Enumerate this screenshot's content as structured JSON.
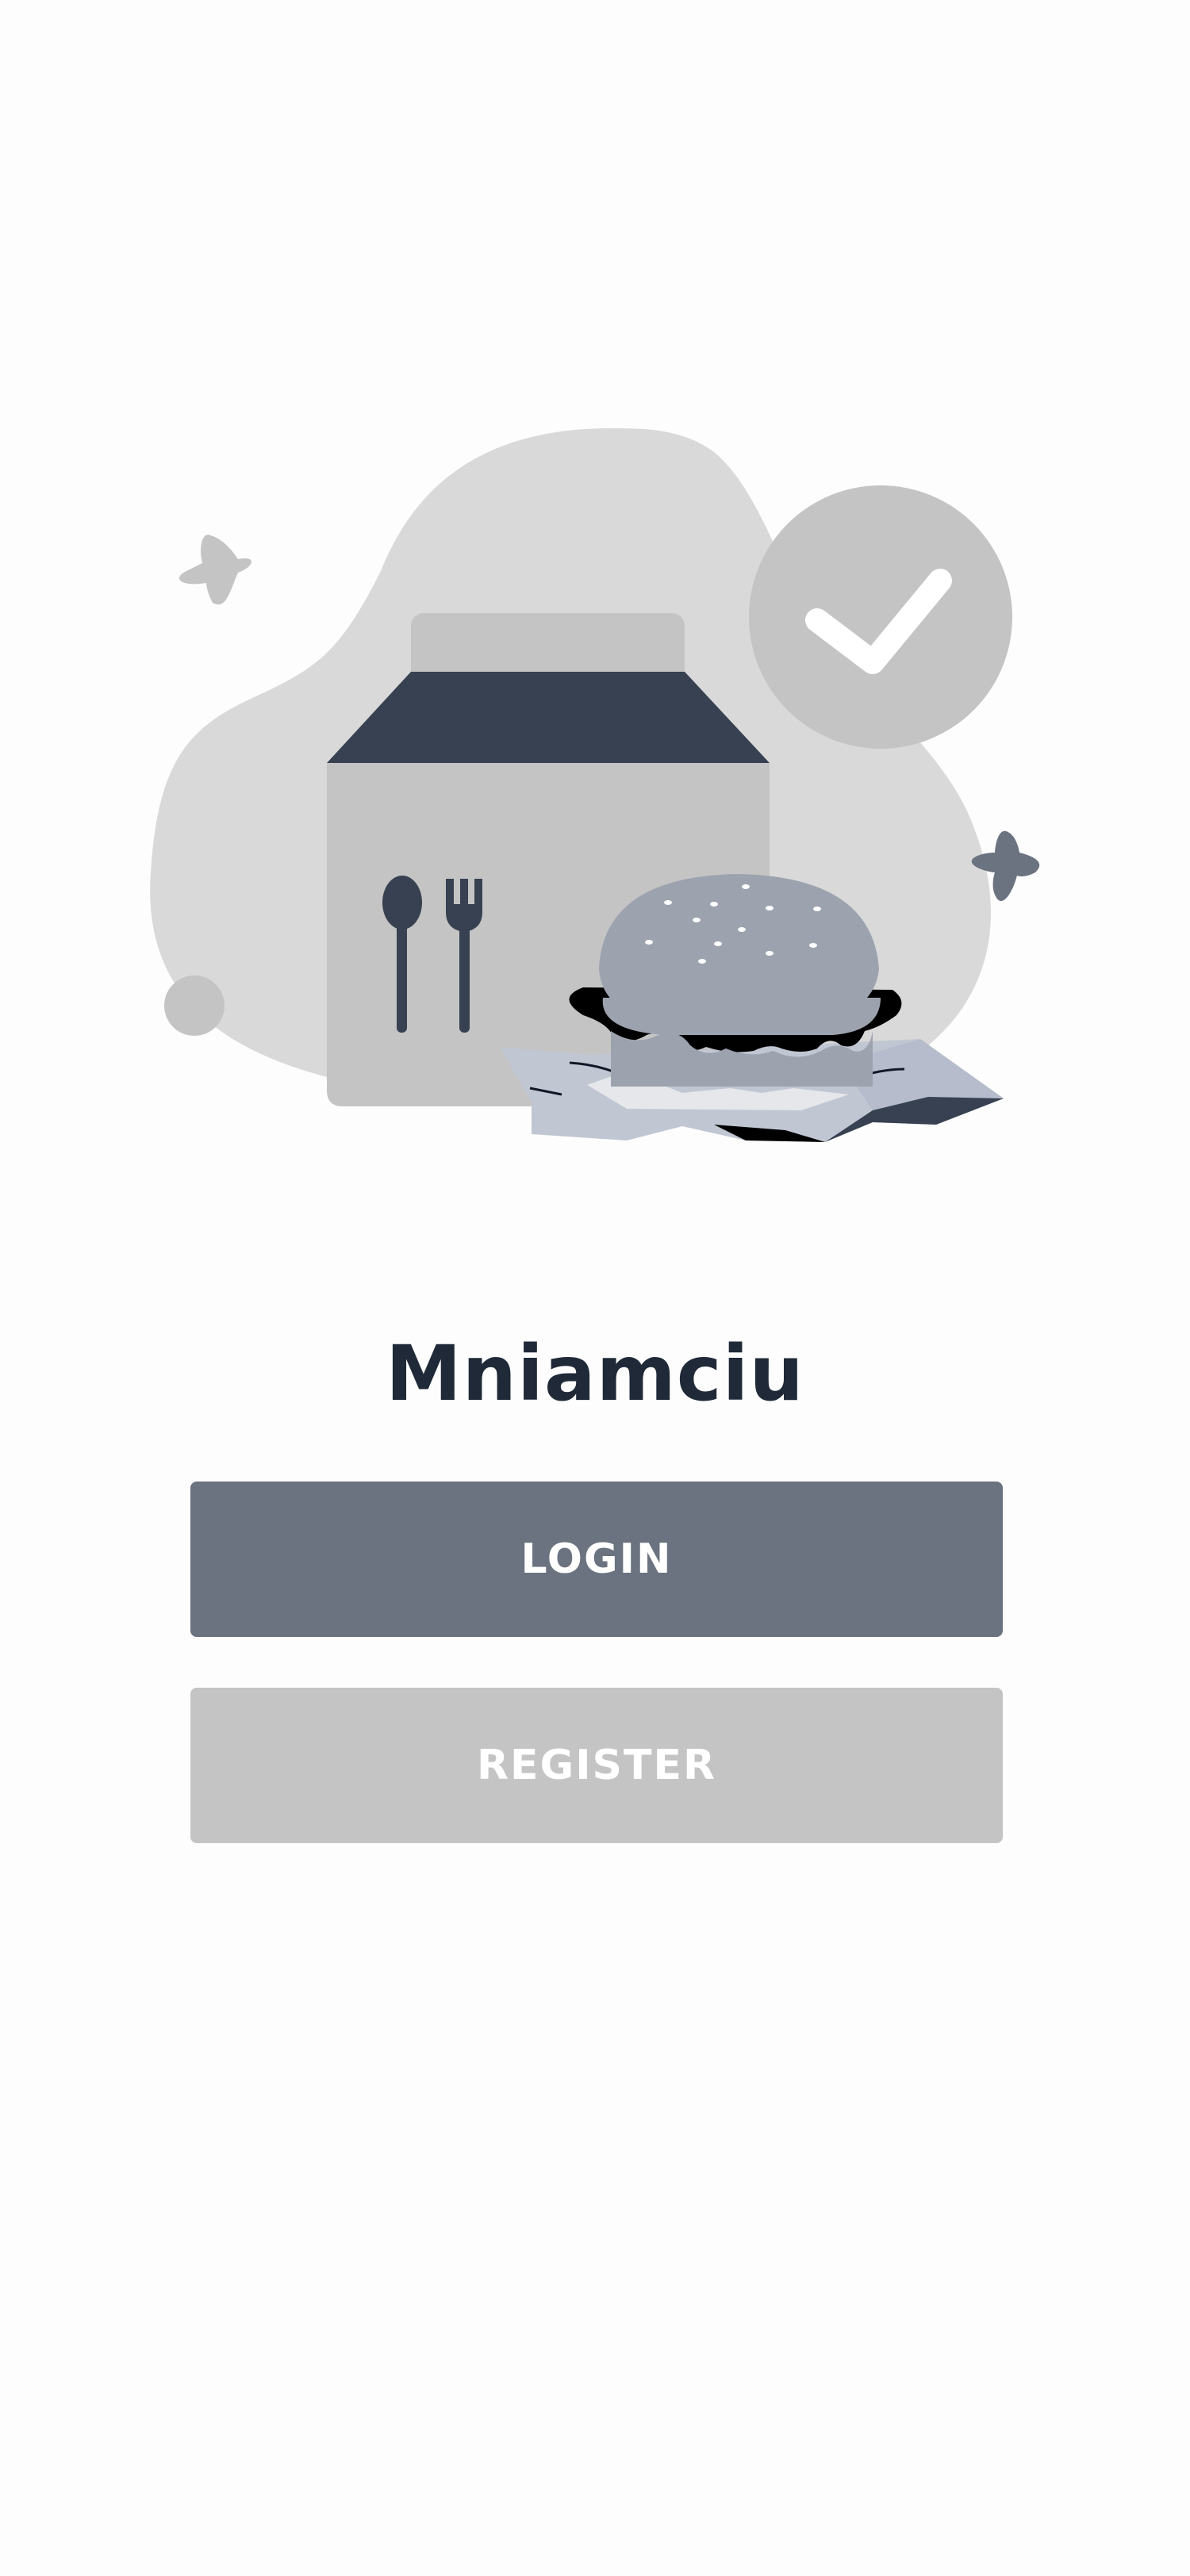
{
  "app": {
    "title": "Mniamciu"
  },
  "actions": {
    "login_label": "LOGIN",
    "register_label": "REGISTER"
  },
  "colors": {
    "background": "#fdfdfd",
    "title": "#1f2937",
    "login_button": "#6b7280",
    "register_button": "#c4c4c4",
    "illustration_blob": "#d9d9d9",
    "illustration_dark": "#374151"
  },
  "illustration": {
    "icons": [
      "sparkle-icon",
      "check-badge-icon",
      "food-box-icon",
      "spoon-icon",
      "fork-icon",
      "burger-icon",
      "wrapper-paper-icon"
    ]
  }
}
